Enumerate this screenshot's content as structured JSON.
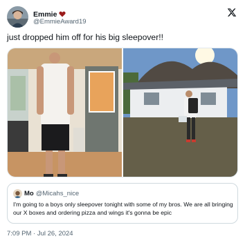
{
  "author": {
    "display_name": "Emmie",
    "badge_icon": "red-heart-emoji-icon",
    "handle": "@EmmieAward19",
    "avatar_icon": "user-avatar-photo"
  },
  "platform_icon": "x-logo-icon",
  "tweet": {
    "text": "just dropped him off for his big sleepover!!"
  },
  "media": [
    {
      "description_icon": "man-standing-in-kitchen-photo"
    },
    {
      "description_icon": "man-walking-toward-house-photo"
    }
  ],
  "quoted_tweet": {
    "display_name": "Mo",
    "handle": "@Micahs_nice",
    "text": "I'm going to a boys only sleepover tonight with some of my bros. We are all bringing our X boxes and ordering pizza and wings it's gonna be epic"
  },
  "timestamp": "7:09 PM · Jul 26, 2024",
  "colors": {
    "text_primary": "#0f1419",
    "text_secondary": "#536471",
    "border": "#cfd9de"
  }
}
